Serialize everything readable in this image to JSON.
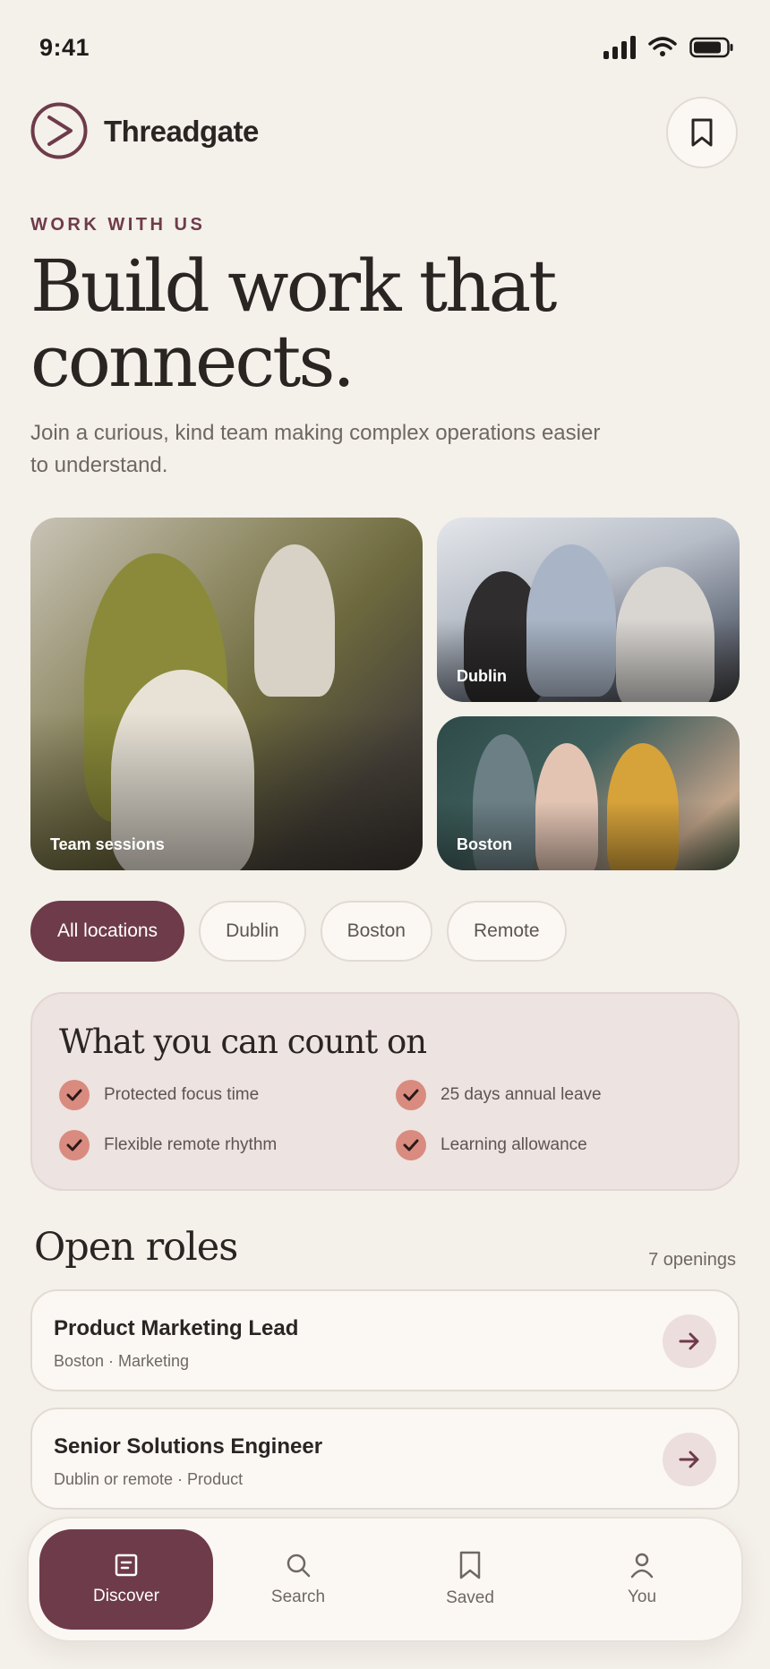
{
  "status": {
    "time": "9:41"
  },
  "brand": {
    "name": "Threadgate"
  },
  "hero": {
    "eyebrow": "WORK WITH US",
    "title_line1": "Build work that",
    "title_line2": "connects.",
    "subtitle": "Join a curious, kind team making complex operations easier to understand."
  },
  "photos": [
    {
      "caption": "Team sessions"
    },
    {
      "caption": "Dublin"
    },
    {
      "caption": "Boston"
    }
  ],
  "filters": [
    {
      "label": "All locations",
      "active": true
    },
    {
      "label": "Dublin",
      "active": false
    },
    {
      "label": "Boston",
      "active": false
    },
    {
      "label": "Remote",
      "active": false
    }
  ],
  "benefits": {
    "title": "What you can count on",
    "items": [
      "Protected focus time",
      "25 days annual leave",
      "Flexible remote rhythm",
      "Learning allowance"
    ]
  },
  "roles": {
    "title": "Open roles",
    "count": "7 openings",
    "items": [
      {
        "title": "Product Marketing Lead",
        "meta": "Boston · Marketing"
      },
      {
        "title": "Senior Solutions Engineer",
        "meta": "Dublin or remote · Product"
      }
    ]
  },
  "nav": [
    {
      "label": "Discover",
      "icon": "document-icon",
      "active": true
    },
    {
      "label": "Search",
      "icon": "search-icon",
      "active": false
    },
    {
      "label": "Saved",
      "icon": "bookmark-icon",
      "active": false
    },
    {
      "label": "You",
      "icon": "person-icon",
      "active": false
    }
  ],
  "colors": {
    "accent": "#6e3b4a",
    "background": "#f4f0ea",
    "check": "#d98b7f",
    "card": "#fbf8f4"
  }
}
